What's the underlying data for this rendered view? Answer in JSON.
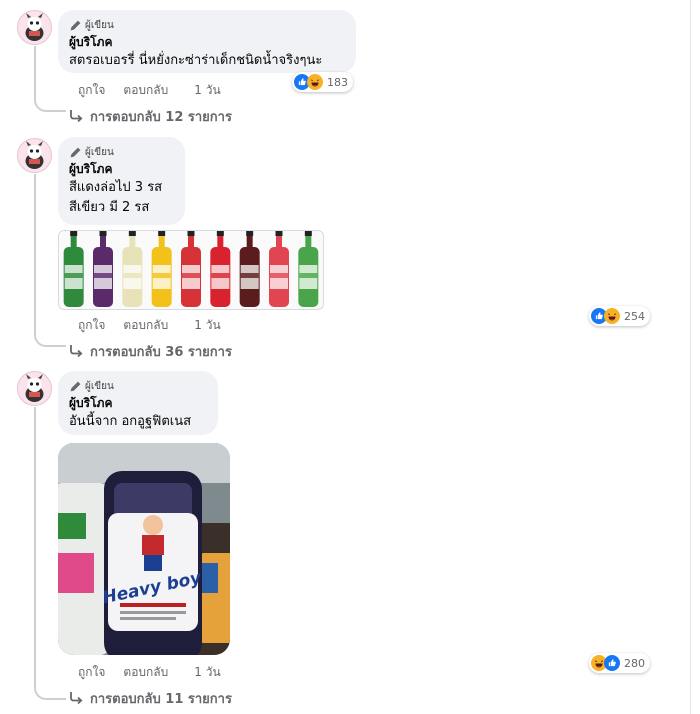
{
  "comments": [
    {
      "badge": "ผู้เขียน",
      "author": "ผู้บริโภค",
      "text": "สตรอเบอรรี่ นี่หยั่งกะซ่าร่าเด็กชนิดน้ำจริงๆนะ",
      "reaction_icons": [
        "like-icon",
        "haha-icon"
      ],
      "reaction_count": "183",
      "actions": {
        "like": "ถูกใจ",
        "reply": "ตอบกลับ",
        "time": "1 วัน"
      },
      "replies_label": "การตอบกลับ 12 รายการ"
    },
    {
      "badge": "ผู้เขียน",
      "author": "ผู้บริโภค",
      "text": "สีแดงล่อไป 3 รส\nสีเขียว มี 2 รส",
      "reaction_icons": [
        "like-icon",
        "haha-icon"
      ],
      "reaction_count": "254",
      "actions": {
        "like": "ถูกใจ",
        "reply": "ตอบกลับ",
        "time": "1 วัน"
      },
      "replies_label": "การตอบกลับ 36 รายการ",
      "bottle_colors": [
        "#2f8a3c",
        "#5a2a6b",
        "#e8e2b8",
        "#f2c21a",
        "#d63238",
        "#d8222e",
        "#5a1c1c",
        "#e14552",
        "#4aa54a"
      ]
    },
    {
      "badge": "ผู้เขียน",
      "author": "ผู้บริโภค",
      "text": "อันนี้จาก อกอูฐฟิตเนส",
      "reaction_icons": [
        "haha-icon",
        "like-icon"
      ],
      "reaction_count": "280",
      "actions": {
        "like": "ถูกใจ",
        "reply": "ตอบกลับ",
        "time": "1 วัน"
      },
      "replies_label": "การตอบกลับ 11 รายการ",
      "photo_label": "Heavy boy"
    }
  ],
  "colors": {
    "like": "#1877f2",
    "haha": "#f7b125",
    "secondary_text": "#65676b",
    "bubble": "#f0f2f5"
  }
}
